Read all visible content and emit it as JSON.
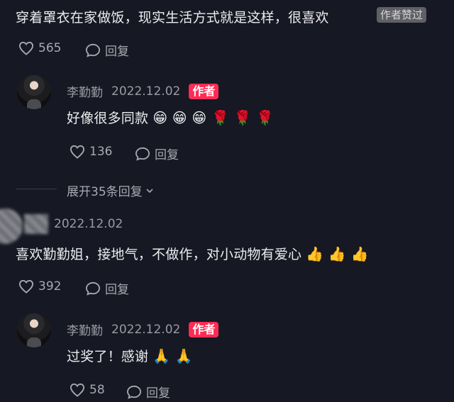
{
  "comment1": {
    "text": "穿着罩衣在家做饭，现实生活方式就是这样，很喜欢",
    "author_liked_badge": "作者赞过",
    "likes": "565",
    "reply_label": "回复"
  },
  "reply1": {
    "username": "李勤勤",
    "date": "2022.12.02",
    "author_badge": "作者",
    "text": "好像很多同款",
    "emojis": "😁 😁 😁 🌹 🌹 🌹",
    "likes": "136",
    "reply_label": "回复"
  },
  "expand": {
    "label": "展开35条回复"
  },
  "comment2": {
    "date": "2022.12.02",
    "text": "喜欢勤勤姐，接地气，不做作，对小动物有爱心",
    "emojis": "👍 👍 👍",
    "likes": "392",
    "reply_label": "回复"
  },
  "reply2": {
    "username": "李勤勤",
    "date": "2022.12.02",
    "author_badge": "作者",
    "text": "过奖了！感谢",
    "emojis": "🙏 🙏",
    "likes": "58",
    "reply_label": "回复"
  },
  "colors": {
    "background": "#161823",
    "author_badge": "#fe2c55",
    "liked_badge": "#5f5f66"
  }
}
